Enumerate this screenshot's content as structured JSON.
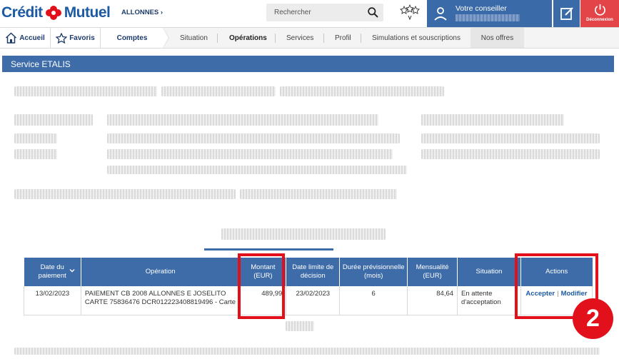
{
  "header": {
    "logo_left": "Crédit",
    "logo_right": "Mutuel",
    "branch": "ALLONNES ›",
    "search_placeholder": "Rechercher",
    "advisor_label": "Votre conseiller",
    "logout_label": "Déconnexion",
    "brand_color": "#1d5aa4",
    "advisor_bg": "#3b6aa8",
    "logout_bg": "#e24447"
  },
  "nav": {
    "accueil": "Accueil",
    "favoris": "Favoris",
    "comptes": "Comptes",
    "situation": "Situation",
    "operations": "Opérations",
    "services": "Services",
    "profil": "Profil",
    "simulations": "Simulations et souscriptions",
    "offres": "Nos offres"
  },
  "section": {
    "title": "Service ETALIS"
  },
  "table": {
    "headers": {
      "date_paiement": "Date du paiement",
      "operation": "Opération",
      "montant": "Montant (EUR)",
      "date_limite": "Date limite de décision",
      "duree": "Durée prévisionnelle (mois)",
      "mensualite": "Mensualité (EUR)",
      "situation": "Situation",
      "actions": "Actions"
    },
    "rows": [
      {
        "date_paiement": "13/02/2023",
        "operation": "PAIEMENT CB 2008 ALLONNES E JOSELITO CARTE 75836476 DCR012223408819496 - Carte",
        "montant": "489,99",
        "date_limite": "23/02/2023",
        "duree": "6",
        "mensualite": "84,64",
        "situation": "En attente d'acceptation",
        "action_accept": "Accepter",
        "action_modify": "Modifier"
      }
    ]
  },
  "annotation": {
    "badge": "2",
    "color": "#e2101b"
  }
}
